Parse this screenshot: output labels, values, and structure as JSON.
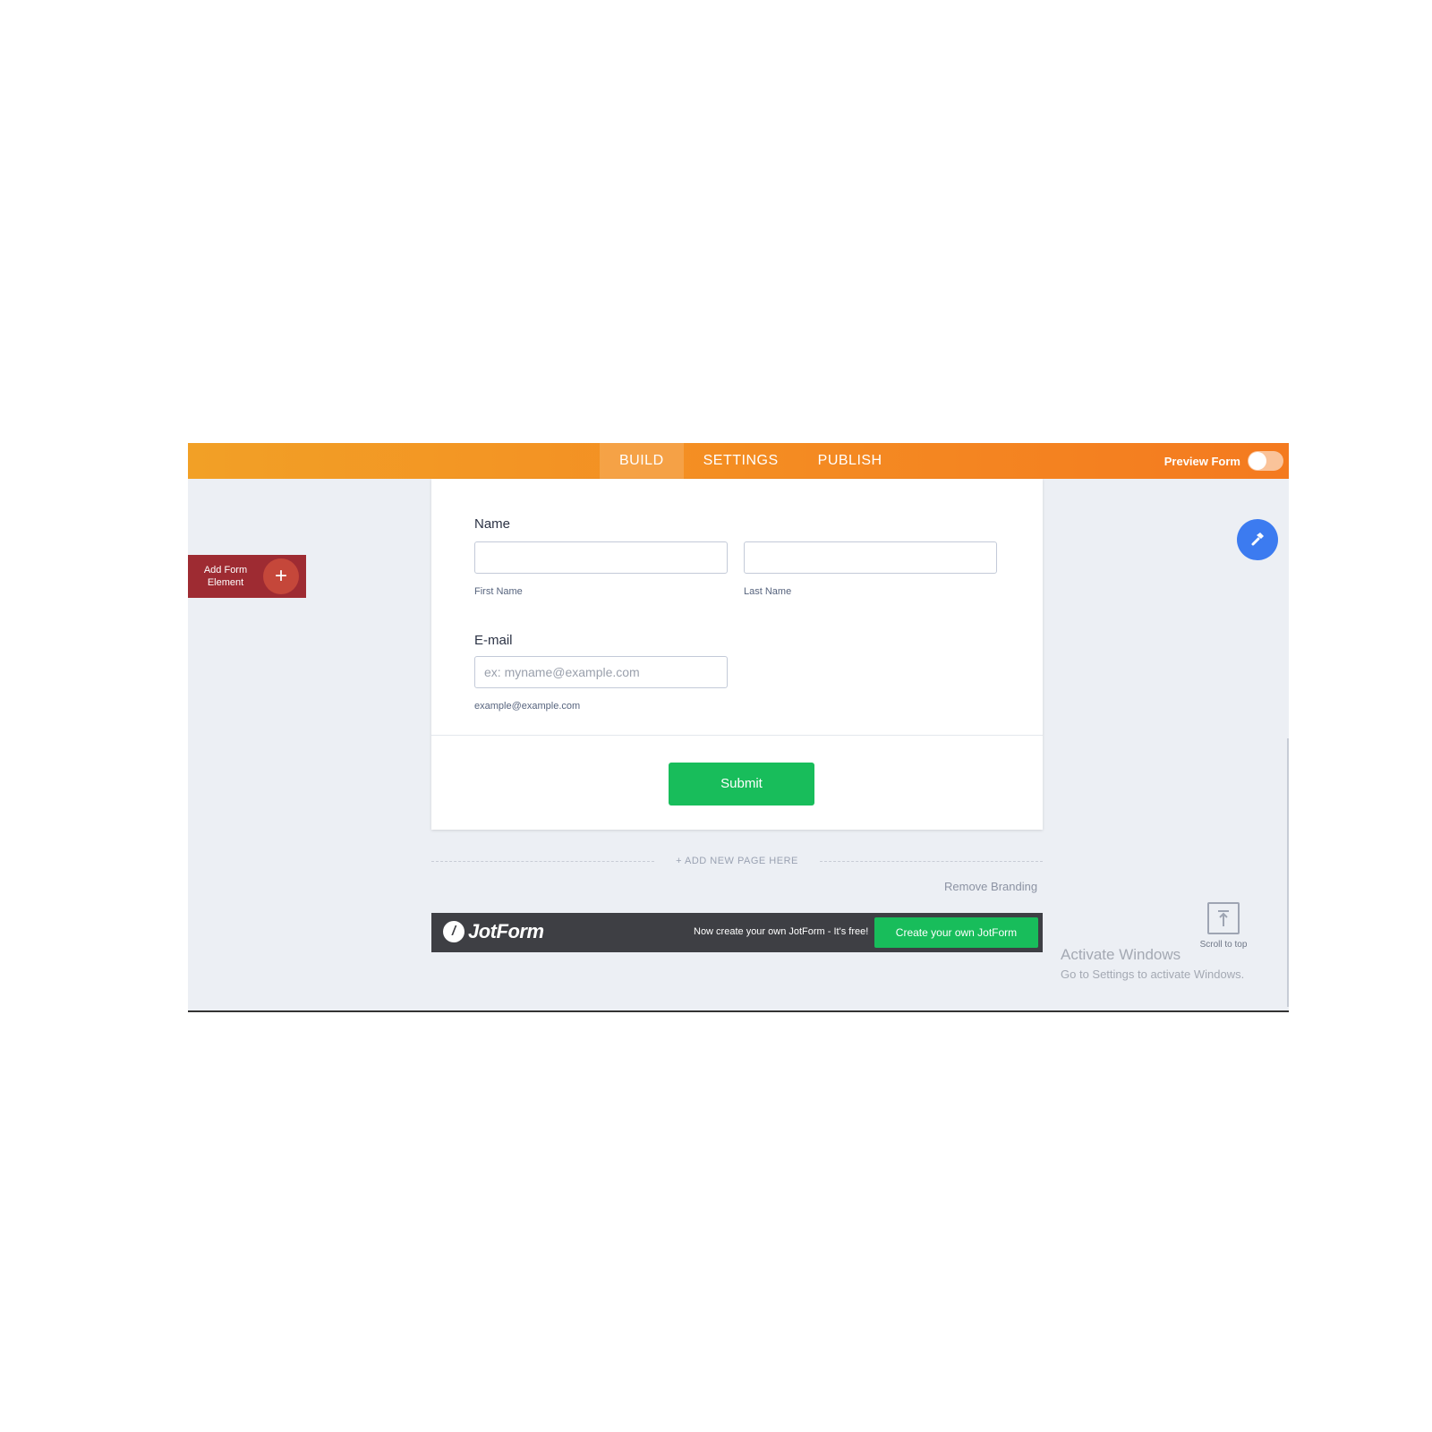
{
  "topbar": {
    "tabs": [
      "BUILD",
      "SETTINGS",
      "PUBLISH"
    ],
    "active_tab": "BUILD",
    "preview_label": "Preview Form",
    "preview_toggle_on": false
  },
  "left_panel": {
    "add_element_label": "Add Form Element",
    "add_element_icon": "plus-icon"
  },
  "form": {
    "name_label": "Name",
    "first_name_sublabel": "First Name",
    "last_name_sublabel": "Last Name",
    "first_name_value": "",
    "last_name_value": "",
    "email_label": "E-mail",
    "email_placeholder": "ex: myname@example.com",
    "email_sublabel": "example@example.com",
    "submit_label": "Submit"
  },
  "canvas": {
    "add_page_label": "+ ADD NEW PAGE HERE",
    "remove_branding": "Remove Branding"
  },
  "footer": {
    "logo_text": "JotForm",
    "tagline": "Now create your own JotForm - It's free!",
    "cta_label": "Create your own JotForm"
  },
  "right": {
    "tool_icon": "hammer-icon",
    "scroll_label": "Scroll to top"
  },
  "watermark": {
    "title": "Activate Windows",
    "subtitle": "Go to Settings to activate Windows."
  },
  "colors": {
    "topbar_start": "#f2a026",
    "topbar_end": "#f47a1f",
    "add_element_bg": "#9e2b32",
    "submit_green": "#18bd5b",
    "tool_blue": "#3c7bf0",
    "footer_bg": "#3e3f44"
  }
}
